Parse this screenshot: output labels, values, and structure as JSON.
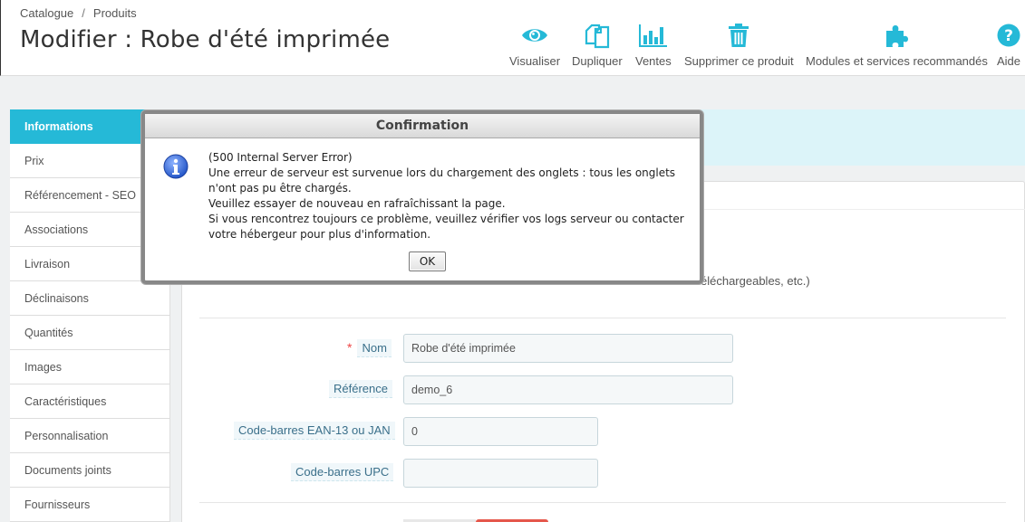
{
  "breadcrumb": {
    "item1": "Catalogue",
    "separator": "/",
    "item2": "Produits"
  },
  "page_title": "Modifier : Robe d'été imprimée",
  "toolbar": {
    "preview": "Visualiser",
    "duplicate": "Dupliquer",
    "sales": "Ventes",
    "delete": "Supprimer ce produit",
    "modules": "Modules et services recommandés",
    "help": "Aide",
    "accent": "#25b9d7"
  },
  "tabs": [
    "Informations",
    "Prix",
    "Référencement - SEO",
    "Associations",
    "Livraison",
    "Déclinaisons",
    "Quantités",
    "Images",
    "Caractéristiques",
    "Personnalisation",
    "Documents joints",
    "Fournisseurs"
  ],
  "form": {
    "partial_text": "éléchargeables, etc.)",
    "name_label": "Nom",
    "name_value": "Robe d'été imprimée",
    "reference_label": "Référence",
    "reference_value": "demo_6",
    "ean_label": "Code-barres EAN-13 ou JAN",
    "ean_value": "0",
    "upc_label": "Code-barres UPC",
    "upc_value": ""
  },
  "dialog": {
    "title": "Confirmation",
    "line1": "(500 Internal Server Error)",
    "line2": "Une erreur de serveur est survenue lors du chargement des onglets : tous les onglets n'ont pas pu être chargés.",
    "line3": "Veuillez essayer de nouveau en rafraîchissant la page.",
    "line4": "Si vous rencontrez toujours ce problème, veuillez vérifier vos logs serveur ou contacter votre hébergeur pour plus d'information.",
    "ok": "OK",
    "icon": "info-icon"
  }
}
